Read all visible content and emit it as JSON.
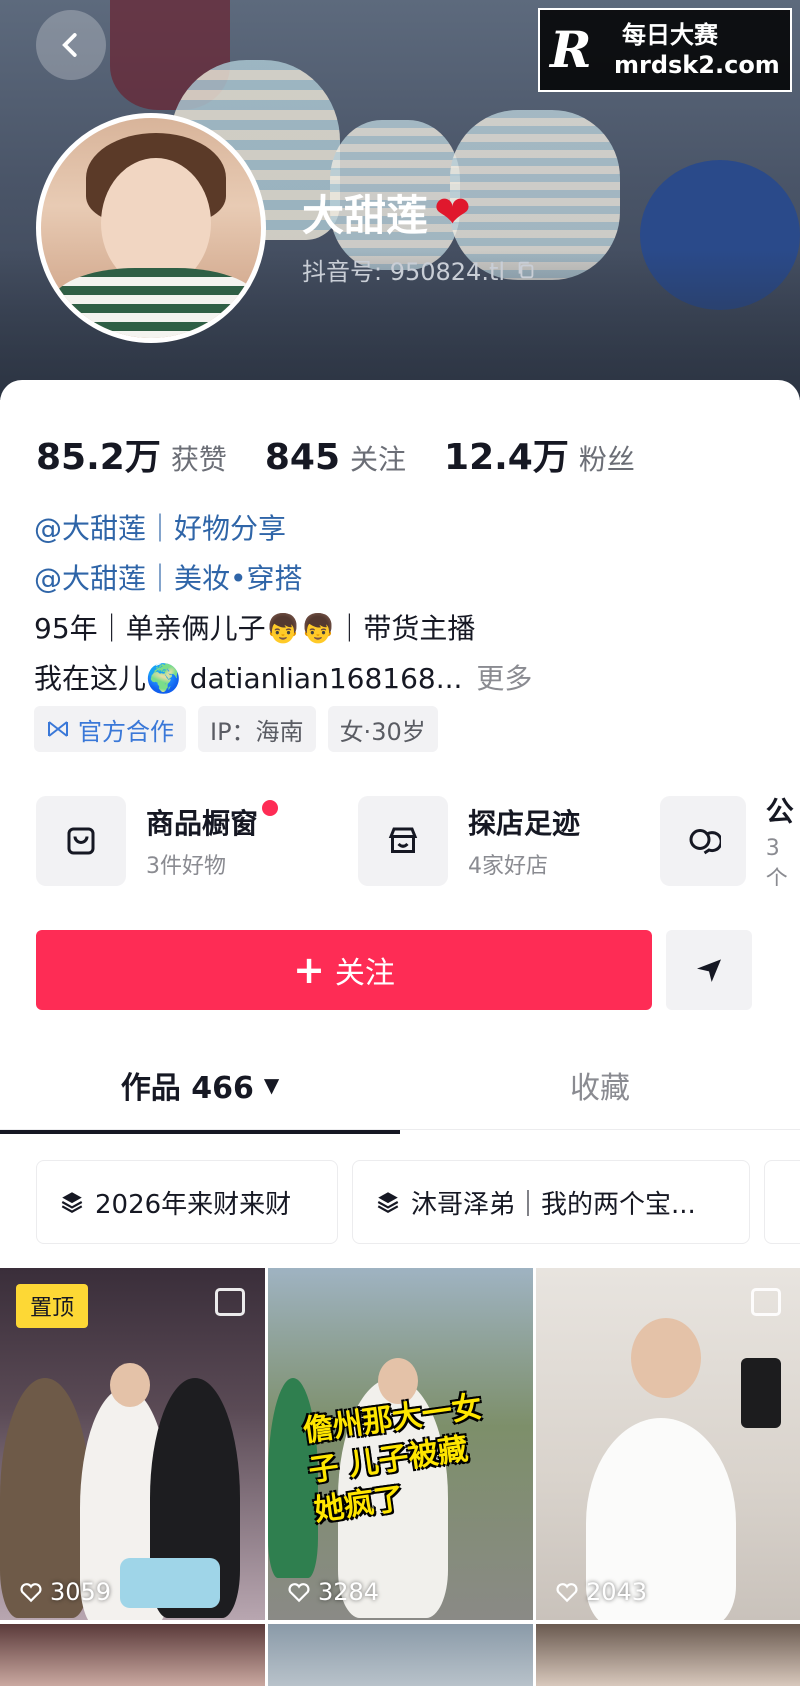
{
  "watermark": {
    "logo": "R",
    "line1": "每日大赛",
    "line2": "mrdsk2.com"
  },
  "profile": {
    "nickname": "大甜莲",
    "heart": "❤",
    "douyin_id": "抖音号: 950824.tl"
  },
  "stats": [
    {
      "num": "85.2万",
      "label": "获赞"
    },
    {
      "num": "845",
      "label": "关注"
    },
    {
      "num": "12.4万",
      "label": "粉丝"
    }
  ],
  "bio": {
    "line1": "@大甜莲｜好物分享",
    "line2": "@大甜莲｜美妆•穿搭",
    "line3": "95年｜单亲俩儿子👦👦｜带货主播",
    "line4": "我在这儿🌍 datianlian168168...",
    "more": "更多"
  },
  "tags": {
    "official": "官方合作",
    "ip": "IP：海南",
    "gender_age": "女·30岁"
  },
  "services": [
    {
      "title": "商品橱窗",
      "sub": "3件好物",
      "icon": "shopping-bag-icon"
    },
    {
      "title": "探店足迹",
      "sub": "4家好店",
      "icon": "store-icon"
    },
    {
      "title": "公",
      "sub": "3个",
      "icon": "chat-bubbles-icon"
    }
  ],
  "actions": {
    "follow": "关注",
    "follow_plus": "+"
  },
  "tabs": {
    "works": "作品 466",
    "favorites": "收藏",
    "caret": "▼"
  },
  "collections": [
    {
      "label": "2026年来财来财"
    },
    {
      "label": "沐哥泽弟｜我的两个宝..."
    }
  ],
  "videos": [
    {
      "likes": "3059",
      "pinned": "置顶"
    },
    {
      "likes": "3284",
      "overlay": "儋州那大一女子 儿子被藏 她疯了"
    },
    {
      "likes": "2043"
    }
  ],
  "colors": {
    "accent": "#fe2c55",
    "link": "#2f65a8",
    "official": "#3a78d8"
  }
}
